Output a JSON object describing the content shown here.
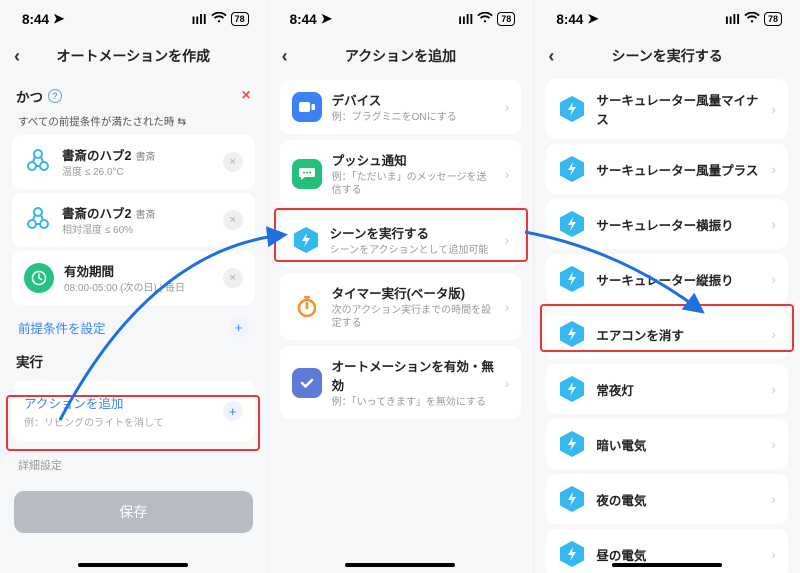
{
  "status": {
    "time": "8:44",
    "battery": "78"
  },
  "screen1": {
    "title": "オートメーションを作成",
    "condition_label": "かつ",
    "subtext": "すべての前提条件が満たされた時",
    "cond1_title": "書斎のハブ2",
    "cond1_tag": "書斎",
    "cond1_sub": "温度 ≤ 26.0°C",
    "cond2_title": "書斎のハブ2",
    "cond2_tag": "書斎",
    "cond2_sub": "相対湿度 ≤ 60%",
    "cond3_title": "有効期間",
    "cond3_sub": "08:00-05:00 (次の日) | 毎日",
    "set_precond": "前提条件を設定",
    "exec_label": "実行",
    "add_action": "アクションを追加",
    "add_action_sub": "例：リビングのライトを消して",
    "detail": "詳細設定",
    "save": "保存"
  },
  "screen2": {
    "title": "アクションを追加",
    "items": [
      {
        "title": "デバイス",
        "sub": "例：プラグミニをONにする",
        "icon": "device",
        "color": "#3b82f6"
      },
      {
        "title": "プッシュ通知",
        "sub": "例：「ただいま」のメッセージを送信する",
        "icon": "bubble",
        "color": "#22c07a"
      },
      {
        "title": "シーンを実行する",
        "sub": "シーンをアクションとして追加可能",
        "icon": "hex",
        "color": "#34b8ef"
      },
      {
        "title": "タイマー実行(ベータ版)",
        "sub": "次のアクション実行までの時間を設定する",
        "icon": "timer",
        "color": "#f5912b"
      },
      {
        "title": "オートメーションを有効・無効",
        "sub": "例：「いってきます」を無効にする",
        "icon": "check",
        "color": "#5b7bd6"
      }
    ]
  },
  "screen3": {
    "title": "シーンを実行する",
    "items": [
      "サーキュレーター風量マイナス",
      "サーキュレーター風量プラス",
      "サーキュレーター横振り",
      "サーキュレーター縦振り",
      "エアコンを消す",
      "常夜灯",
      "暗い電気",
      "夜の電気",
      "昼の電気"
    ]
  }
}
